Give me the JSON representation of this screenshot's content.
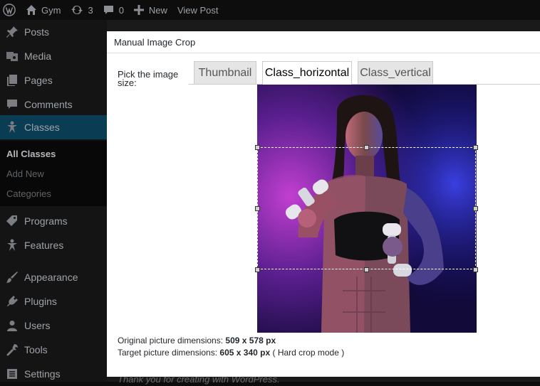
{
  "adminbar": {
    "site_name": "Gym",
    "updates_count": "3",
    "comments_count": "0",
    "new_label": "New",
    "view_post_label": "View Post"
  },
  "sidebar": {
    "items": [
      {
        "label": "Posts",
        "icon": "pushpin-icon"
      },
      {
        "label": "Media",
        "icon": "media-icon"
      },
      {
        "label": "Pages",
        "icon": "pages-icon"
      },
      {
        "label": "Comments",
        "icon": "comments-icon"
      },
      {
        "label": "Classes",
        "icon": "star-figure-icon",
        "current": true
      },
      {
        "label": "Programs",
        "icon": "tag-icon"
      },
      {
        "label": "Features",
        "icon": "star-figure-icon"
      },
      {
        "label": "Appearance",
        "icon": "paintbrush-icon"
      },
      {
        "label": "Plugins",
        "icon": "plugin-icon"
      },
      {
        "label": "Users",
        "icon": "users-icon"
      },
      {
        "label": "Tools",
        "icon": "wrench-icon"
      },
      {
        "label": "Settings",
        "icon": "settings-icon"
      }
    ],
    "submenu": [
      "All Classes",
      "Add New",
      "Categories"
    ]
  },
  "modal": {
    "title": "Manual Image Crop",
    "pick_label": "Pick the image size:",
    "tabs": [
      "Thumbnail",
      "Class_horizontal",
      "Class_vertical"
    ],
    "active_tab": "Class_horizontal",
    "original_label": "Original picture dimensions:",
    "original_value": "509 x 578 px",
    "target_label": "Target picture dimensions:",
    "target_value": "605 x 340 px",
    "crop_mode": "( Hard crop mode )"
  },
  "footer": {
    "text": "Thank you for creating with WordPress."
  },
  "colors": {
    "admin_bar": "#0d0d0d",
    "sidebar": "#141414",
    "current_menu": "#0a3c54",
    "modal_bg": "#ffffff",
    "tab_inactive": "#e5e5e5"
  }
}
